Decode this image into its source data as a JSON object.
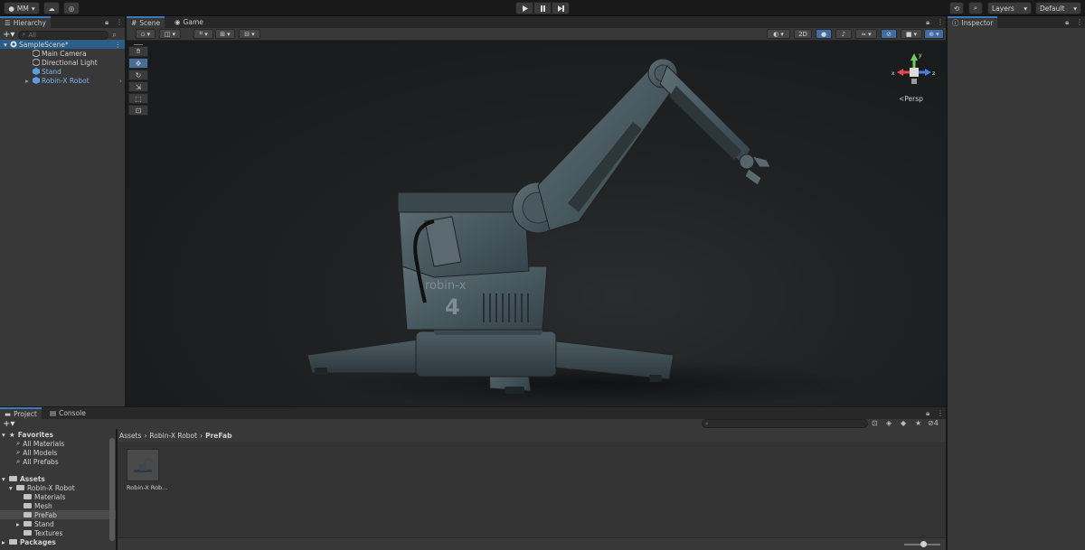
{
  "toolbar": {
    "account": "MM",
    "layers": "Layers",
    "layout": "Default"
  },
  "hierarchy": {
    "tab": "Hierarchy",
    "search_placeholder": "All",
    "items": [
      {
        "label": "SampleScene*"
      },
      {
        "label": "Main Camera"
      },
      {
        "label": "Directional Light"
      },
      {
        "label": "Stand"
      },
      {
        "label": "Robin-X Robot"
      }
    ]
  },
  "scene": {
    "tabs": [
      "Scene",
      "Game"
    ],
    "mode_2d": "2D",
    "gizmo_view": "Persp",
    "axes": {
      "x": "x",
      "y": "y",
      "z": "z"
    },
    "robot_label": "robin-x",
    "robot_number": "4"
  },
  "inspector": {
    "tab": "Inspector"
  },
  "project": {
    "tabs": [
      "Project",
      "Console"
    ],
    "favorites": {
      "label": "Favorites",
      "items": [
        "All Materials",
        "All Models",
        "All Prefabs"
      ]
    },
    "assets": {
      "label": "Assets",
      "robot_folder": "Robin-X Robot",
      "subfolders": [
        "Materials",
        "Mesh",
        "PreFab",
        "Stand",
        "Textures"
      ]
    },
    "packages": "Packages",
    "breadcrumb": [
      "Assets",
      "Robin-X Robot",
      "PreFab"
    ],
    "asset_item": "Robin-X Rob...",
    "hidden_count": "4"
  }
}
